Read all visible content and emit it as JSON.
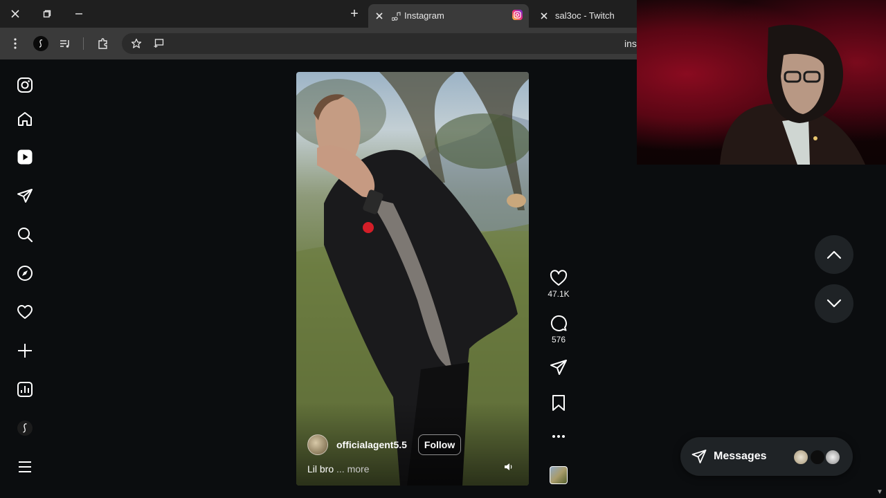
{
  "browser": {
    "tabs": [
      {
        "title": "Instagram",
        "active": true,
        "favicon": "instagram-icon"
      },
      {
        "title": "sal3oc - Twitch",
        "active": false,
        "favicon": "close-icon"
      }
    ],
    "new_tab_glyph": "+",
    "url_fragment": "ins"
  },
  "sidebar": {
    "items": [
      {
        "name": "instagram-logo-icon"
      },
      {
        "name": "home-icon"
      },
      {
        "name": "reels-icon"
      },
      {
        "name": "direct-send-icon"
      },
      {
        "name": "search-icon"
      },
      {
        "name": "explore-compass-icon"
      },
      {
        "name": "notifications-heart-icon"
      },
      {
        "name": "create-plus-icon"
      },
      {
        "name": "dashboard-chart-icon"
      },
      {
        "name": "threads-icon"
      },
      {
        "name": "more-menu-icon"
      }
    ]
  },
  "reel": {
    "author": "officialagent5.5",
    "follow_label": "Follow",
    "caption": "Lil bro",
    "more_label": "... more"
  },
  "actions": {
    "likes": "47.1K",
    "comments": "576"
  },
  "messages": {
    "label": "Messages"
  },
  "colors": {
    "background": "#0b0d0f",
    "chrome_tabbar": "#1f1f1f",
    "chrome_toolbar": "#3a3a3a",
    "pill": "#1f2326",
    "instagram_gradient": [
      "#f9ce34",
      "#ee2a7b",
      "#6228d7"
    ]
  }
}
